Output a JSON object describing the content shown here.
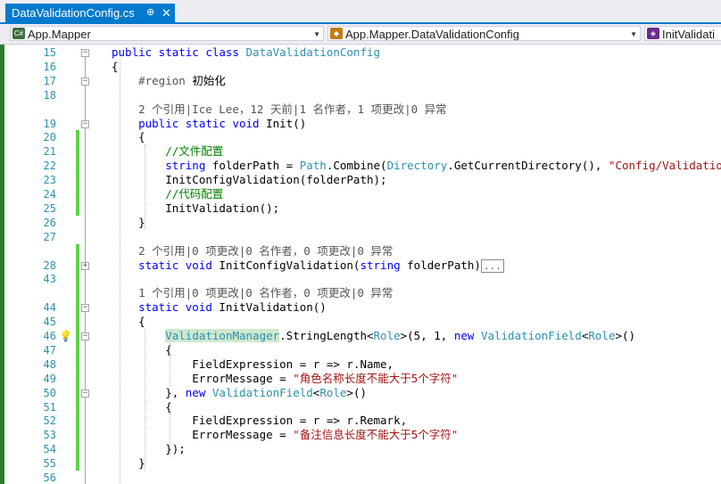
{
  "tab": {
    "filename": "DataValidationConfig.cs",
    "pin": "⊕",
    "close": "✕"
  },
  "navigation": {
    "project": {
      "label": "App.Mapper",
      "icon": "C#"
    },
    "type": {
      "label": "App.Mapper.DataValidationConfig",
      "icon": "◆"
    },
    "member": {
      "label": "InitValidati",
      "icon": "◈"
    }
  },
  "editor": {
    "lines": [
      {
        "n": "15",
        "fold": "-",
        "change": false,
        "parts": [
          [
            "kw",
            "public static class "
          ],
          [
            "ty",
            "DataValidationConfig"
          ]
        ]
      },
      {
        "n": "16",
        "fold": "",
        "change": false,
        "parts": [
          [
            "",
            "{"
          ]
        ]
      },
      {
        "n": "17",
        "fold": "-",
        "change": false,
        "parts": [
          [
            "gr",
            "    #region "
          ],
          [
            "",
            "初始化"
          ]
        ]
      },
      {
        "n": "18",
        "fold": "",
        "change": false,
        "parts": [
          [
            "",
            ""
          ]
        ]
      },
      {
        "n": "",
        "fold": "",
        "change": false,
        "parts": [
          [
            "gr",
            "    2 个引用|Ice Lee，12 天前|1 名作者，1 项更改|0 异常"
          ]
        ]
      },
      {
        "n": "19",
        "fold": "-",
        "change": false,
        "parts": [
          [
            "kw",
            "    public static void "
          ],
          [
            "",
            "Init()"
          ]
        ]
      },
      {
        "n": "20",
        "fold": "",
        "change": true,
        "parts": [
          [
            "",
            "    {"
          ]
        ]
      },
      {
        "n": "21",
        "fold": "",
        "change": true,
        "parts": [
          [
            "cm",
            "        //文件配置"
          ]
        ]
      },
      {
        "n": "22",
        "fold": "",
        "change": true,
        "parts": [
          [
            "kw",
            "        string "
          ],
          [
            "",
            "folderPath = "
          ],
          [
            "ty",
            "Path"
          ],
          [
            "",
            ".Combine("
          ],
          [
            "ty",
            "Directory"
          ],
          [
            "",
            ".GetCurrentDirectory(), "
          ],
          [
            "st",
            "\"Config/Validation\""
          ],
          [
            "",
            ");"
          ]
        ]
      },
      {
        "n": "23",
        "fold": "",
        "change": true,
        "parts": [
          [
            "",
            "        InitConfigValidation(folderPath);"
          ]
        ]
      },
      {
        "n": "24",
        "fold": "",
        "change": true,
        "parts": [
          [
            "cm",
            "        //代码配置"
          ]
        ]
      },
      {
        "n": "25",
        "fold": "",
        "change": true,
        "parts": [
          [
            "",
            "        InitValidation();"
          ]
        ]
      },
      {
        "n": "26",
        "fold": "",
        "change": false,
        "parts": [
          [
            "",
            "    }"
          ]
        ]
      },
      {
        "n": "27",
        "fold": "",
        "change": false,
        "parts": [
          [
            "",
            ""
          ]
        ]
      },
      {
        "n": "",
        "fold": "",
        "change": true,
        "parts": [
          [
            "gr",
            "    2 个引用|0 项更改|0 名作者，0 项更改|0 异常"
          ]
        ]
      },
      {
        "n": "28",
        "fold": "+",
        "change": true,
        "parts": [
          [
            "kw",
            "    static void "
          ],
          [
            "",
            "InitConfigValidation("
          ],
          [
            "kw",
            "string "
          ],
          [
            "",
            "folderPath)"
          ],
          [
            "collapsed",
            "..."
          ]
        ]
      },
      {
        "n": "43",
        "fold": "",
        "change": true,
        "parts": [
          [
            "",
            ""
          ]
        ]
      },
      {
        "n": "",
        "fold": "",
        "change": true,
        "parts": [
          [
            "gr",
            "    1 个引用|0 项更改|0 名作者，0 项更改|0 异常"
          ]
        ]
      },
      {
        "n": "44",
        "fold": "-",
        "change": true,
        "parts": [
          [
            "kw",
            "    static void "
          ],
          [
            "",
            "InitValidation()"
          ]
        ]
      },
      {
        "n": "45",
        "fold": "",
        "change": true,
        "parts": [
          [
            "",
            "    {"
          ]
        ]
      },
      {
        "n": "46",
        "fold": "-",
        "change": true,
        "bulb": true,
        "parts": [
          [
            "",
            "        "
          ],
          [
            "hl",
            "ValidationManager"
          ],
          [
            "",
            ".StringLength<"
          ],
          [
            "ty",
            "Role"
          ],
          [
            "",
            ">(5, 1, "
          ],
          [
            "kw",
            "new "
          ],
          [
            "ty",
            "ValidationField"
          ],
          [
            "",
            "<"
          ],
          [
            "ty",
            "Role"
          ],
          [
            "",
            ">()"
          ]
        ]
      },
      {
        "n": "47",
        "fold": "",
        "change": true,
        "parts": [
          [
            "",
            "        {"
          ]
        ]
      },
      {
        "n": "48",
        "fold": "",
        "change": true,
        "parts": [
          [
            "",
            "            FieldExpression = r => r.Name,"
          ]
        ]
      },
      {
        "n": "49",
        "fold": "",
        "change": true,
        "parts": [
          [
            "",
            "            ErrorMessage = "
          ],
          [
            "st",
            "\"角色名称长度不能大于5个字符\""
          ]
        ]
      },
      {
        "n": "50",
        "fold": "-",
        "change": true,
        "parts": [
          [
            "",
            "        }, "
          ],
          [
            "kw",
            "new "
          ],
          [
            "ty",
            "ValidationField"
          ],
          [
            "",
            "<"
          ],
          [
            "ty",
            "Role"
          ],
          [
            "",
            ">()"
          ]
        ]
      },
      {
        "n": "51",
        "fold": "",
        "change": true,
        "parts": [
          [
            "",
            "        {"
          ]
        ]
      },
      {
        "n": "52",
        "fold": "",
        "change": true,
        "parts": [
          [
            "",
            "            FieldExpression = r => r.Remark,"
          ]
        ]
      },
      {
        "n": "53",
        "fold": "",
        "change": true,
        "parts": [
          [
            "",
            "            ErrorMessage = "
          ],
          [
            "st",
            "\"备注信息长度不能大于5个字符\""
          ]
        ]
      },
      {
        "n": "54",
        "fold": "",
        "change": true,
        "parts": [
          [
            "",
            "        });"
          ]
        ]
      },
      {
        "n": "55",
        "fold": "",
        "change": true,
        "parts": [
          [
            "",
            "    }"
          ]
        ]
      },
      {
        "n": "56",
        "fold": "",
        "change": false,
        "parts": [
          [
            "",
            ""
          ]
        ]
      }
    ]
  },
  "colors": {
    "accent": "#007acc",
    "keyword": "#0000ff",
    "type": "#2b91af",
    "string": "#a31515",
    "comment": "#008000",
    "change_bar": "#5fd14a"
  }
}
